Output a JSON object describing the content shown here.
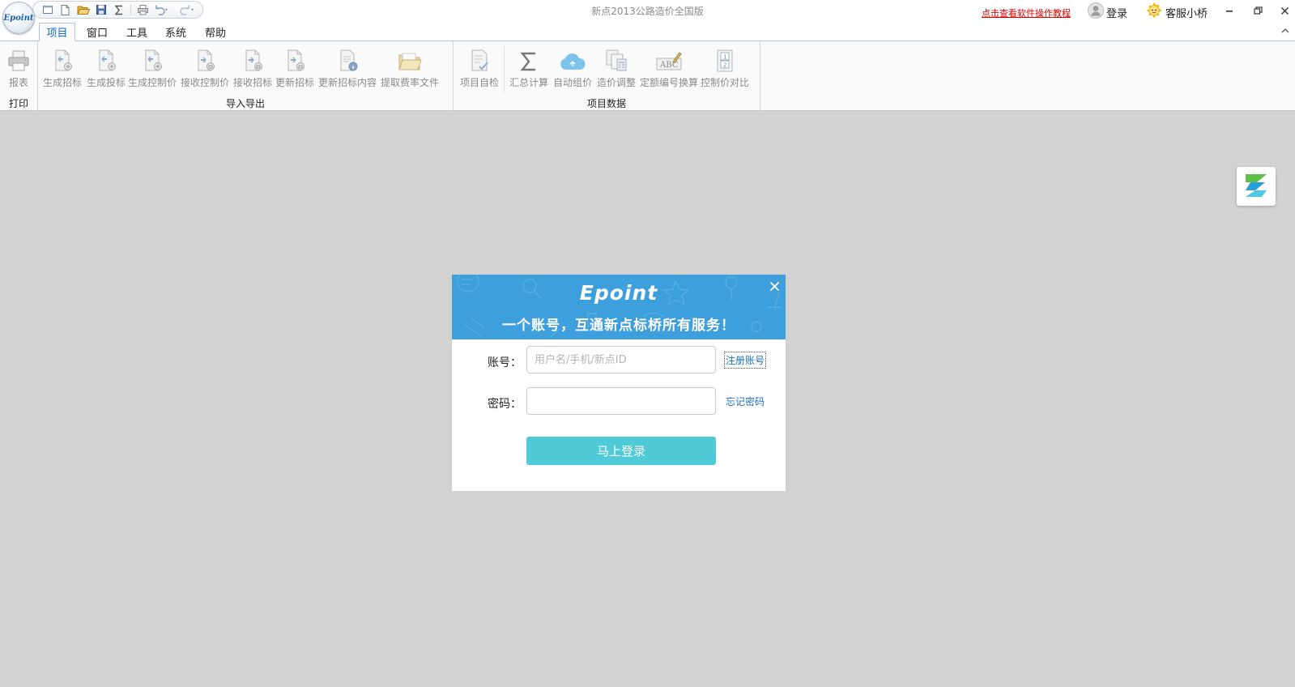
{
  "titlebar": {
    "logo_text": "Epoint",
    "title": "新点2013公路造价全国版",
    "tutorial_link": "点击查看软件操作教程",
    "login_label": "登录",
    "service_label": "客服小桥",
    "qat_icons": [
      "new-window-icon",
      "new-file-icon",
      "open-folder-icon",
      "save-icon",
      "sum-icon",
      "print-icon",
      "undo-icon",
      "redo-icon"
    ]
  },
  "tabs": [
    {
      "label": "项目",
      "active": true
    },
    {
      "label": "窗口"
    },
    {
      "label": "工具"
    },
    {
      "label": "系统"
    },
    {
      "label": "帮助"
    }
  ],
  "ribbon": {
    "groups": [
      {
        "label": "打印",
        "buttons": [
          {
            "label": "报表",
            "icon": "printer-icon"
          }
        ]
      },
      {
        "label": "导入导出",
        "buttons": [
          {
            "label": "生成招标",
            "icon": "export-doc-icon"
          },
          {
            "label": "生成投标",
            "icon": "export-doc-icon"
          },
          {
            "label": "生成控制价",
            "icon": "export-doc-icon"
          },
          {
            "label": "接收控制价",
            "icon": "import-doc-icon"
          },
          {
            "label": "接收招标",
            "icon": "import-doc-icon"
          },
          {
            "label": "更新招标",
            "icon": "import-doc-icon"
          },
          {
            "label": "更新招标内容",
            "icon": "doc-info-icon"
          },
          {
            "label": "提取费率文件",
            "icon": "folder-icon"
          }
        ]
      },
      {
        "label": "项目数据",
        "buttons": [
          {
            "label": "项目自检",
            "icon": "checklist-icon"
          },
          {
            "label": "汇总计算",
            "icon": "sigma-icon"
          },
          {
            "label": "自动组价",
            "icon": "cloud-icon"
          },
          {
            "label": "造价调整",
            "icon": "calculator-icon"
          },
          {
            "label": "定额编号换算",
            "icon": "abc-edit-icon"
          },
          {
            "label": "控制价对比",
            "icon": "compare-icon"
          }
        ]
      }
    ]
  },
  "login": {
    "brand": "Epoint",
    "slogan": "一个账号，互通新点标桥所有服务！",
    "account_label": "账号：",
    "account_placeholder": "用户名/手机/新点ID",
    "account_value": "",
    "password_label": "密码：",
    "password_value": "",
    "register_link": "注册账号",
    "forgot_link": "忘记密码",
    "submit_label": "马上登录"
  },
  "colors": {
    "dialog_header": "#3d9fdc",
    "submit_button": "#4fcad6",
    "link": "#1d6fb8",
    "tutorial_link": "#e00000",
    "workspace": "#d2d2d2"
  }
}
